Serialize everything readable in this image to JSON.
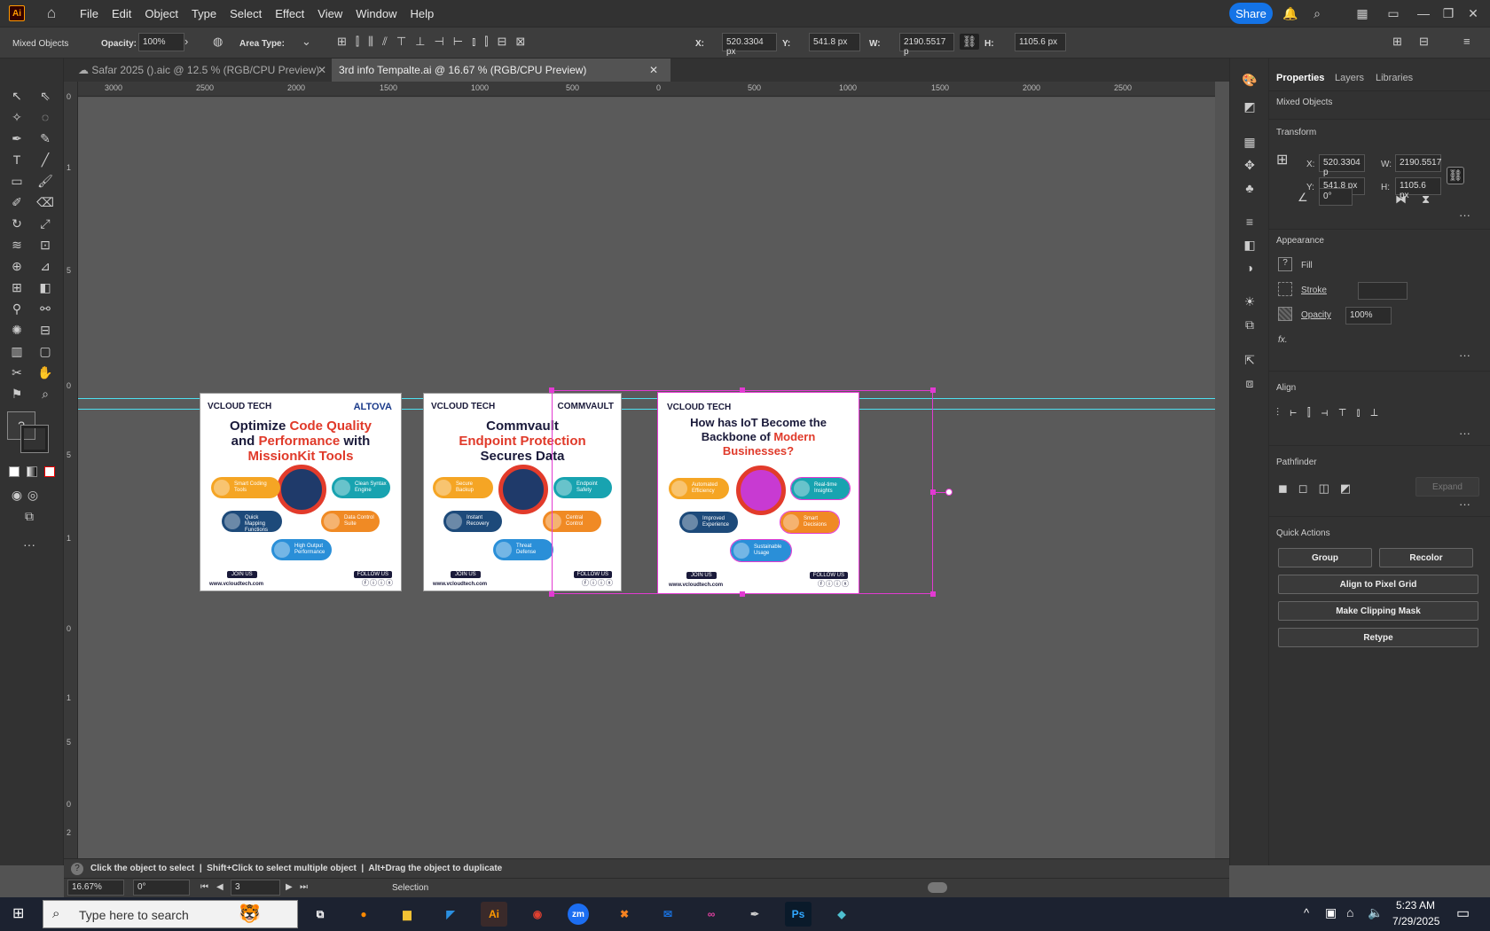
{
  "app": {
    "logo": "Ai",
    "menus": [
      "File",
      "Edit",
      "Object",
      "Type",
      "Select",
      "Effect",
      "View",
      "Window",
      "Help"
    ],
    "share_label": "Share"
  },
  "control_bar": {
    "selection_type": "Mixed Objects",
    "opacity_label": "Opacity:",
    "opacity_value": "100%",
    "area_type_label": "Area Type:",
    "x_label": "X:",
    "x_value": "520.3304 px",
    "y_label": "Y:",
    "y_value": "541.8 px",
    "w_label": "W:",
    "w_value": "2190.5517 p",
    "h_label": "H:",
    "h_value": "1105.6 px"
  },
  "tabs": [
    {
      "label": "Safar 2025 ().aic @ 12.5 % (RGB/CPU Preview)"
    },
    {
      "label": "3rd info Tempalte.ai @ 16.67 % (RGB/CPU Preview)"
    }
  ],
  "ruler_top": [
    "3000",
    "2500",
    "2000",
    "1500",
    "1000",
    "500",
    "0",
    "500",
    "1000",
    "1500",
    "2000",
    "2500"
  ],
  "ruler_left": [
    "0",
    "1",
    "5",
    "0",
    "5",
    "1",
    "0",
    "1",
    "5",
    "0",
    "2",
    "2",
    "5"
  ],
  "artboards": [
    {
      "brand": "VCLOUD TECH",
      "partner": "ALTOVA",
      "line1": "Optimize ",
      "line1_red": "Code Quality",
      "line2": "and ",
      "line2_red": "Performance",
      "line2b": " with",
      "line3_red": "MissionKit Tools",
      "pills": [
        "Smart Coding Tools",
        "Clean Syntax Engine",
        "Quick Mapping Functions",
        "Data Control Suite",
        "High Output Performance"
      ],
      "join": "JOIN US",
      "follow": "FOLLOW US",
      "web": "www.vcloudtech.com"
    },
    {
      "brand": "VCLOUD TECH",
      "partner": "COMMVAULT",
      "line1": "Commvault",
      "line2_red": "Endpoint Protection",
      "line3": "Secures Data",
      "pills": [
        "Secure Backup",
        "Endpoint Safety",
        "Instant Recovery",
        "Central Control",
        "Threat Defense"
      ],
      "join": "JOIN US",
      "follow": "FOLLOW US",
      "web": "www.vcloudtech.com"
    },
    {
      "brand": "VCLOUD TECH",
      "line1": "How has IoT Become the",
      "line2": "Backbone of ",
      "line2_red": "Modern",
      "line3_red": "Businesses?",
      "pills": [
        "Automated Efficiency",
        "Real-time Insights",
        "Improved Experience",
        "Smart Decisions",
        "Sustainable Usage"
      ],
      "join": "JOIN US",
      "follow": "FOLLOW US",
      "web": "www.vcloudtech.com"
    }
  ],
  "panel": {
    "tabs": [
      "Properties",
      "Layers",
      "Libraries"
    ],
    "selection": "Mixed Objects",
    "transform": {
      "title": "Transform",
      "x_label": "X:",
      "x": "520.3304 p",
      "y_label": "Y:",
      "y": "541.8 px",
      "w_label": "W:",
      "w": "2190.5517",
      "h_label": "H:",
      "h": "1105.6 px",
      "angle": "0°"
    },
    "appearance": {
      "title": "Appearance",
      "fill": "Fill",
      "stroke": "Stroke",
      "opacity_label": "Opacity",
      "opacity": "100%",
      "fx": "fx."
    },
    "align_title": "Align",
    "pathfinder_title": "Pathfinder",
    "expand": "Expand",
    "quick_actions": {
      "title": "Quick Actions",
      "group": "Group",
      "recolor": "Recolor",
      "align_pixel": "Align to Pixel Grid",
      "clip_mask": "Make Clipping Mask",
      "retype": "Retype"
    }
  },
  "status": {
    "hint": "Click the object to select  |  Shift+Click to select multiple object  |  Alt+Drag the object to duplicate",
    "zoom": "16.67%",
    "angle": "0°",
    "artboard_num": "3",
    "tool": "Selection"
  },
  "taskbar": {
    "search_placeholder": "Type here to search",
    "time": "5:23 AM",
    "date": "7/29/2025"
  },
  "colors": {
    "accent": "#1473e6",
    "selection": "#e23ad2",
    "guide": "#4ee0f0",
    "brand_red": "#e03a2a",
    "navy": "#1a1a3a"
  }
}
